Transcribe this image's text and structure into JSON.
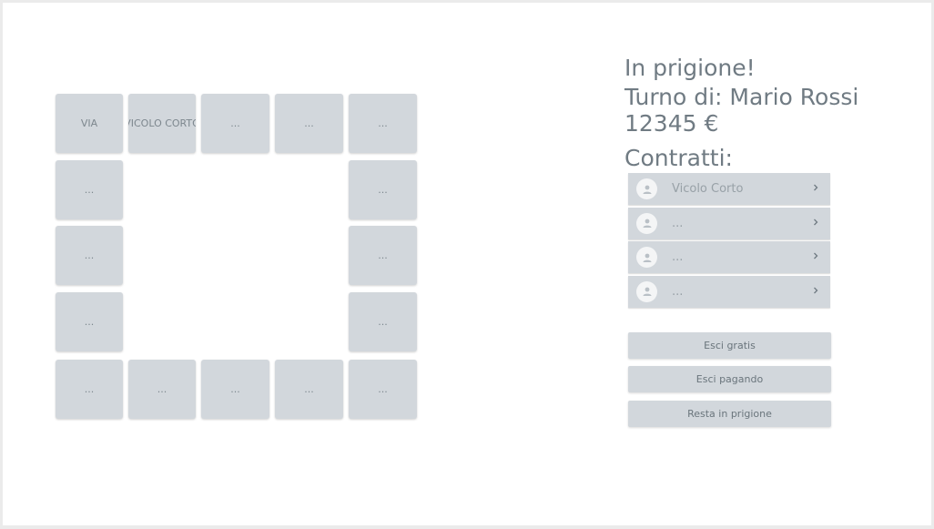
{
  "board": {
    "cells": [
      "VIA",
      "VICOLO CORTO",
      "...",
      "...",
      "...",
      "...",
      "...",
      "...",
      "...",
      "...",
      "...",
      "...",
      "...",
      "...",
      "...",
      "..."
    ]
  },
  "info": {
    "status": "In prigione!",
    "turn": "Turno di: Mario Rossi",
    "money": "12345 €",
    "contracts_title": "Contratti:"
  },
  "contracts": [
    {
      "label": "Vicolo Corto",
      "icon": "person-icon"
    },
    {
      "label": "...",
      "icon": "person-icon"
    },
    {
      "label": "...",
      "icon": "person-icon"
    },
    {
      "label": "...",
      "icon": "person-icon"
    }
  ],
  "actions": {
    "free_exit": "Esci gratis",
    "paid_exit": "Esci pagando",
    "stay": "Resta in prigione"
  },
  "colors": {
    "cell_bg": "#d2d7dc",
    "text": "#707b83",
    "avatar_bg": "#f4f5f6"
  }
}
